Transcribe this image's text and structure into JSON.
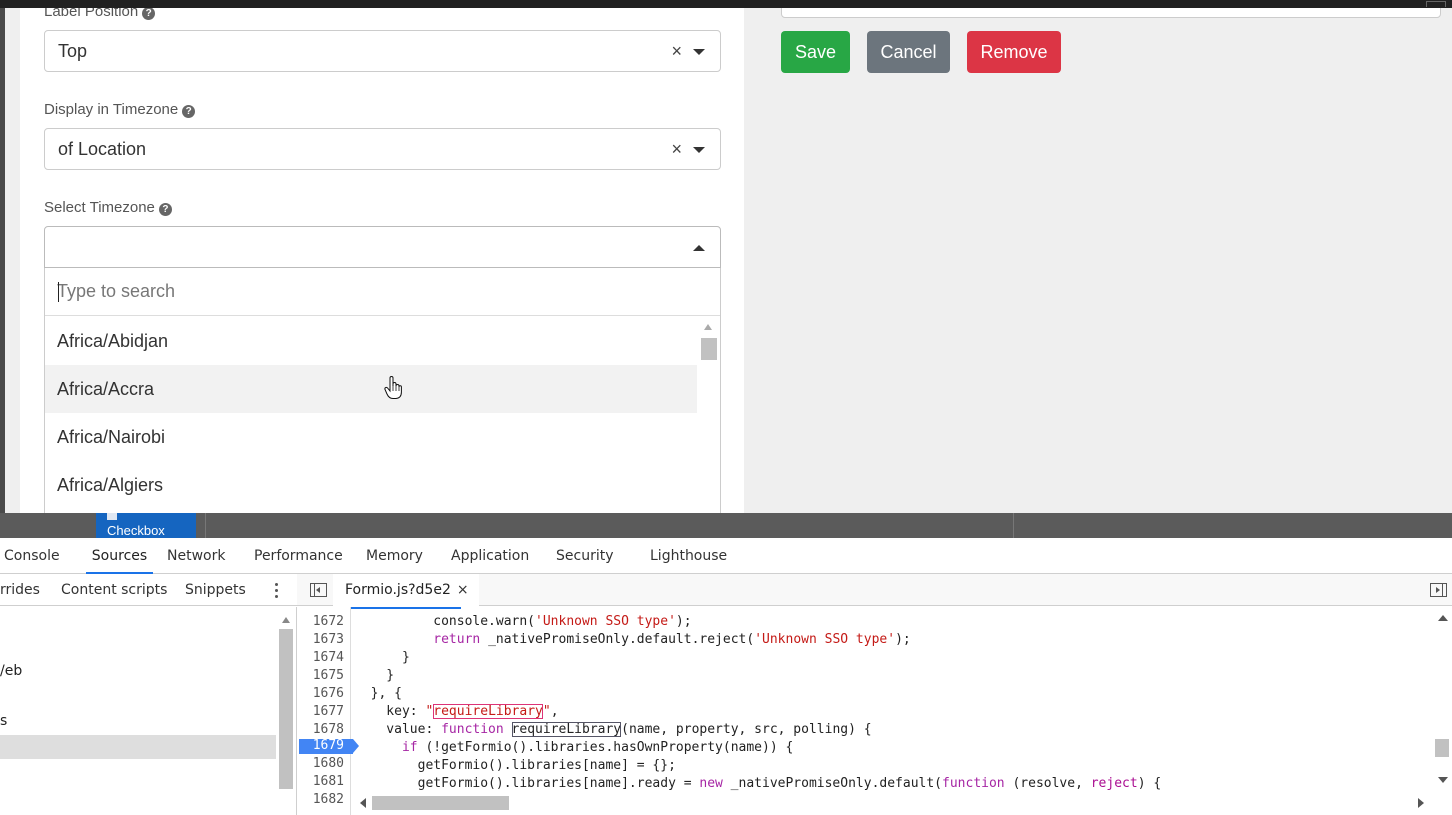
{
  "form": {
    "label_position": {
      "label": "Label Position",
      "value": "Top"
    },
    "display_timezone": {
      "label": "Display in Timezone",
      "value": "of Location"
    },
    "select_timezone": {
      "label": "Select Timezone",
      "value": "",
      "search_placeholder": "Type to search",
      "options": [
        "Africa/Abidjan",
        "Africa/Accra",
        "Africa/Nairobi",
        "Africa/Algiers"
      ],
      "hovered_option": "Africa/Accra"
    },
    "clear_glyph": "×",
    "help_glyph": "?"
  },
  "actions": {
    "save": "Save",
    "cancel": "Cancel",
    "remove": "Remove"
  },
  "colors": {
    "save": "#28a745",
    "cancel": "#6c757d",
    "remove": "#dc3545",
    "devtools_active": "#1a73e8",
    "breakpoint": "#4285f4"
  },
  "behind": {
    "checkbox_tile": "Checkbox"
  },
  "devtools": {
    "tabs": [
      "Console",
      "Sources",
      "Network",
      "Performance",
      "Memory",
      "Application",
      "Security",
      "Lighthouse"
    ],
    "active_tab": "Sources",
    "navigator_tabs": [
      "rrides",
      "Content scripts",
      "Snippets"
    ],
    "tree_rows": [
      "/eb",
      "s"
    ],
    "open_file": "Formio.js?d5e2",
    "close_glyph": "×",
    "breakpoint_line": "1679",
    "line_numbers": [
      "1672",
      "1673",
      "1674",
      "1675",
      "1676",
      "1677",
      "1678",
      "1679",
      "1680",
      "1681",
      "1682"
    ]
  },
  "icons": [
    "help-icon",
    "clear-icon",
    "chevron-down-icon",
    "chevron-up-icon",
    "hand-pointer-icon",
    "kebab-menu-icon",
    "toggle-navigator-icon",
    "toggle-debugger-icon",
    "close-icon"
  ]
}
